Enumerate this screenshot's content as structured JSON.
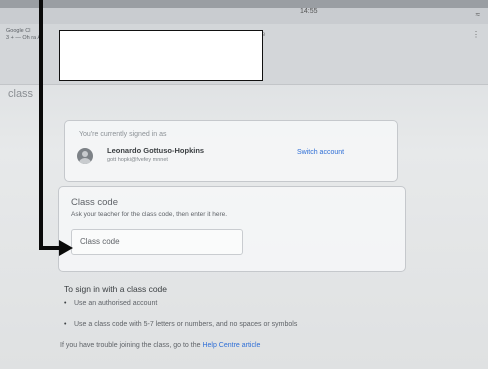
{
  "status_bar": {
    "time": "14:55",
    "wifi_icon": "wifi-icon"
  },
  "browser": {
    "tab_line1": "Google Cl",
    "tab_line2": "",
    "tab_line3": "3 + — Oh ra A",
    "url_hint": "e"
  },
  "page": {
    "heading": "class"
  },
  "account_card": {
    "signed_in_text": "You're currently signed in as",
    "user_name": "Leonardo Gottuso-Hopkins",
    "user_email": "gott hopki@fvefey mnnet",
    "switch_label": "Switch account"
  },
  "class_code_card": {
    "title": "Class code",
    "description": "Ask your teacher for the class code, then enter it here.",
    "input_placeholder": "Class code"
  },
  "instructions": {
    "title": "To sign in with a class code",
    "bullets": [
      "Use an authorised account",
      "Use a class code with 5-7 letters or numbers, and no spaces or symbols"
    ],
    "help_prefix": "If you have trouble joining the class, go to the ",
    "help_link": "Help Centre article"
  },
  "colors": {
    "accent": "#2f6fd6",
    "annotation": "#0a0a0a"
  }
}
